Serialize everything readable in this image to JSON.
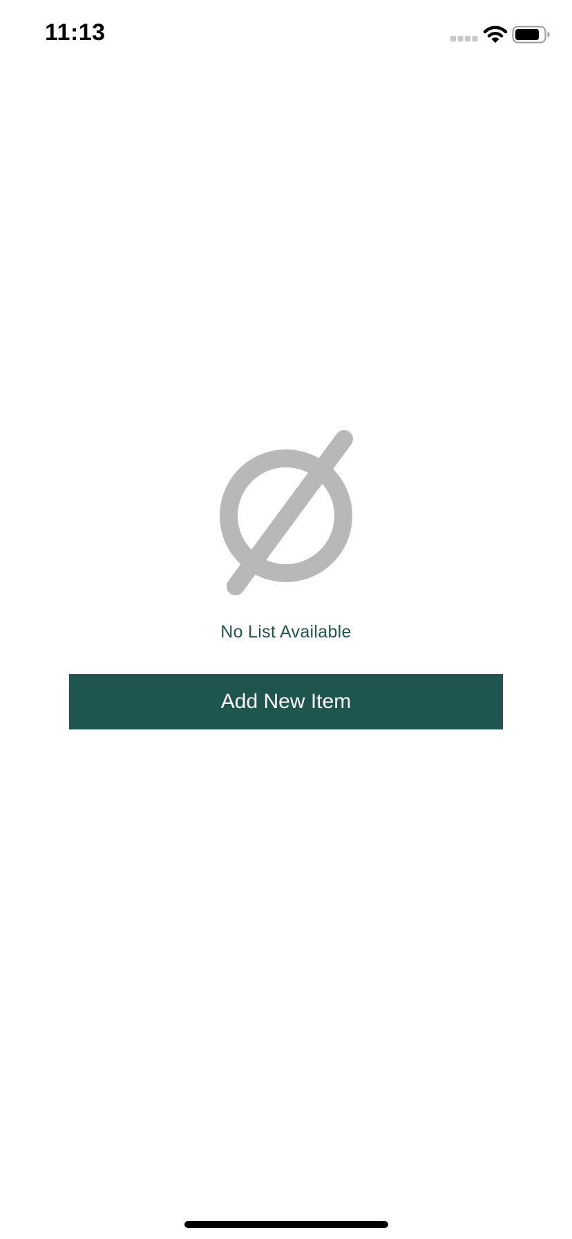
{
  "status_bar": {
    "time": "11:13",
    "icons": [
      "cellular-signal-icon",
      "wifi-icon",
      "battery-icon"
    ]
  },
  "empty_state": {
    "icon": "empty-set-icon",
    "message": "No List Available",
    "add_button_label": "Add New Item"
  },
  "colors": {
    "accent": "#1F554F",
    "icon_gray": "#B8B8B8",
    "background": "#FFFFFF"
  }
}
